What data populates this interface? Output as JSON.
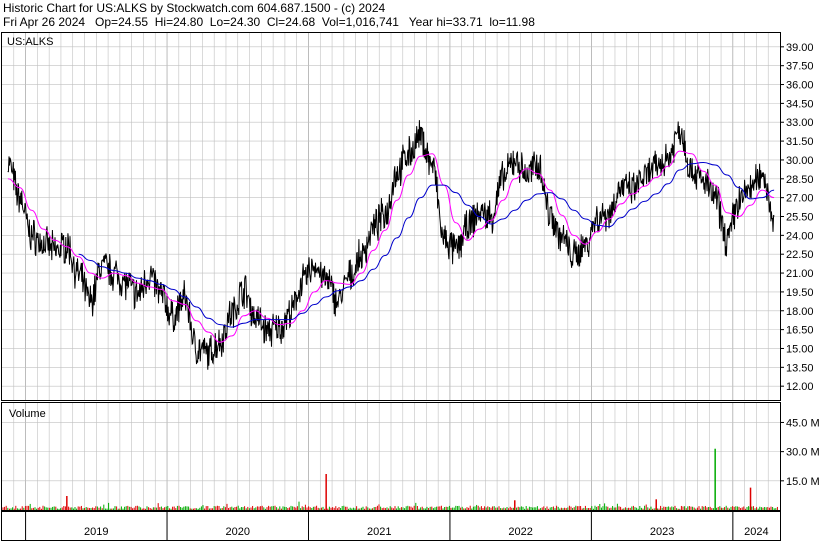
{
  "header": {
    "line1": "Historic Chart for US:ALKS by Stockwatch.com 604.687.1500 - (c) 2024",
    "line2": "Fri Apr 26 2024   Op=24.55  Hi=24.80  Lo=24.30  Cl=24.68  Vol=1,016,741   Year hi=33.71  lo=11.98"
  },
  "price_panel": {
    "symbol": "US:ALKS"
  },
  "volume_panel": {
    "label": "Volume"
  },
  "colors": {
    "price": "#000000",
    "ma_short": "#ff00ff",
    "ma_long": "#0000cc",
    "vol_up": "#00aa00",
    "vol_down": "#dd0000",
    "grid": "#c0c0c0"
  },
  "chart_data": {
    "type": "line",
    "title": "Historic Chart for US:ALKS",
    "x_start": "2018-11",
    "x_end": "2024-04",
    "years": [
      "2019",
      "2020",
      "2021",
      "2022",
      "2023",
      "2024"
    ],
    "y_ticks": [
      "39.00",
      "37.50",
      "36.00",
      "34.50",
      "33.00",
      "31.50",
      "30.00",
      "28.50",
      "27.00",
      "25.50",
      "24.00",
      "22.50",
      "21.00",
      "19.50",
      "18.00",
      "16.50",
      "15.00",
      "13.50",
      "12.00"
    ],
    "ylim": [
      10.9,
      40.1
    ],
    "volume_ticks": [
      "45.0 M",
      "30.0 M",
      "15.0 M"
    ],
    "volume_ylim": [
      0,
      55
    ],
    "close_monthly": [
      [
        "2018-11",
        29.8
      ],
      [
        "2018-12",
        27.0
      ],
      [
        "2019-01",
        24.0
      ],
      [
        "2019-02",
        23.3
      ],
      [
        "2019-03",
        22.8
      ],
      [
        "2019-04",
        23.2
      ],
      [
        "2019-05",
        20.8
      ],
      [
        "2019-06",
        18.8
      ],
      [
        "2019-07",
        21.6
      ],
      [
        "2019-08",
        21.0
      ],
      [
        "2019-09",
        20.2
      ],
      [
        "2019-10",
        19.3
      ],
      [
        "2019-11",
        20.8
      ],
      [
        "2019-12",
        19.3
      ],
      [
        "2020-01",
        17.5
      ],
      [
        "2020-02",
        19.0
      ],
      [
        "2020-03",
        15.0
      ],
      [
        "2020-04",
        14.6
      ],
      [
        "2020-05",
        15.6
      ],
      [
        "2020-06",
        17.8
      ],
      [
        "2020-07",
        19.7
      ],
      [
        "2020-08",
        17.5
      ],
      [
        "2020-09",
        16.4
      ],
      [
        "2020-10",
        16.6
      ],
      [
        "2020-11",
        17.8
      ],
      [
        "2020-12",
        20.3
      ],
      [
        "2021-01",
        21.6
      ],
      [
        "2021-02",
        20.4
      ],
      [
        "2021-03",
        18.8
      ],
      [
        "2021-04",
        20.7
      ],
      [
        "2021-05",
        22.3
      ],
      [
        "2021-06",
        24.6
      ],
      [
        "2021-07",
        25.7
      ],
      [
        "2021-08",
        29.0
      ],
      [
        "2021-09",
        30.5
      ],
      [
        "2021-10",
        31.8
      ],
      [
        "2021-11",
        29.6
      ],
      [
        "2021-12",
        23.6
      ],
      [
        "2022-01",
        22.8
      ],
      [
        "2022-02",
        24.6
      ],
      [
        "2022-03",
        25.8
      ],
      [
        "2022-04",
        25.5
      ],
      [
        "2022-05",
        28.5
      ],
      [
        "2022-06",
        30.0
      ],
      [
        "2022-07",
        28.8
      ],
      [
        "2022-08",
        29.7
      ],
      [
        "2022-09",
        25.7
      ],
      [
        "2022-10",
        23.8
      ],
      [
        "2022-11",
        22.3
      ],
      [
        "2022-12",
        23.3
      ],
      [
        "2023-01",
        25.4
      ],
      [
        "2023-02",
        25.8
      ],
      [
        "2023-03",
        27.8
      ],
      [
        "2023-04",
        27.6
      ],
      [
        "2023-05",
        28.6
      ],
      [
        "2023-06",
        29.4
      ],
      [
        "2023-07",
        30.2
      ],
      [
        "2023-08",
        32.4
      ],
      [
        "2023-09",
        29.2
      ],
      [
        "2023-10",
        28.3
      ],
      [
        "2023-11",
        27.0
      ],
      [
        "2023-12",
        23.7
      ],
      [
        "2024-01",
        26.7
      ],
      [
        "2024-02",
        27.8
      ],
      [
        "2024-03",
        28.9
      ],
      [
        "2024-04",
        25.5
      ]
    ],
    "ma_short_monthly": [
      28.5,
      27.8,
      26.0,
      24.5,
      23.6,
      23.1,
      22.3,
      21.0,
      20.6,
      21.0,
      20.8,
      20.2,
      19.9,
      19.7,
      18.8,
      18.5,
      17.2,
      16.3,
      15.5,
      16.0,
      17.6,
      18.0,
      17.4,
      16.9,
      17.0,
      18.0,
      19.5,
      20.4,
      20.2,
      20.1,
      21.0,
      22.8,
      24.4,
      26.8,
      28.8,
      30.3,
      30.5,
      28.0,
      25.0,
      23.6,
      24.5,
      25.2,
      26.8,
      28.5,
      29.3,
      28.9,
      27.6,
      25.6,
      24.0,
      23.3,
      24.3,
      25.3,
      26.5,
      27.3,
      27.9,
      28.6,
      29.5,
      30.7,
      30.5,
      29.1,
      28.0,
      25.8,
      25.5,
      26.4,
      27.6,
      27.0
    ],
    "ma_long_monthly": [
      null,
      null,
      null,
      null,
      null,
      null,
      22.5,
      22.0,
      21.5,
      21.2,
      21.0,
      20.6,
      20.4,
      20.1,
      19.7,
      19.1,
      18.3,
      17.4,
      16.9,
      16.7,
      17.0,
      17.3,
      17.3,
      17.3,
      17.3,
      17.8,
      18.5,
      19.1,
      19.6,
      19.9,
      20.4,
      21.3,
      22.4,
      23.8,
      25.4,
      27.0,
      28.0,
      28.0,
      27.4,
      26.4,
      25.5,
      24.9,
      25.3,
      26.0,
      26.8,
      27.3,
      27.4,
      26.9,
      26.0,
      25.3,
      24.8,
      24.7,
      25.4,
      26.1,
      26.7,
      27.3,
      28.1,
      29.2,
      29.7,
      29.8,
      29.6,
      28.8,
      27.8,
      26.9,
      27.0,
      27.6
    ],
    "volume_spikes_millions": [
      [
        "2019-04",
        7.2
      ],
      [
        "2021-02",
        18.5
      ],
      [
        "2023-11",
        31.5
      ],
      [
        "2024-02",
        11.5
      ],
      [
        "2022-06",
        5.0
      ],
      [
        "2023-06",
        5.5
      ]
    ]
  }
}
